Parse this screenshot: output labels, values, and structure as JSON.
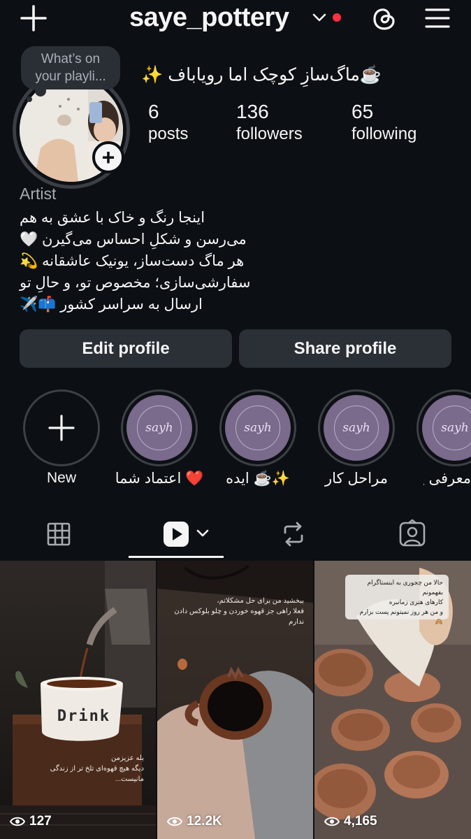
{
  "header": {
    "username": "saye_pottery",
    "icons": [
      "plus-icon",
      "chevron-down-icon",
      "threads-icon",
      "hamburger-menu-icon"
    ],
    "notification_dot_color": "#ff3040"
  },
  "note": {
    "text": "What’s on your playli..."
  },
  "profile": {
    "name": "☕️ماگ‌سازِ کوچک اما رویاباف ✨",
    "stats": [
      {
        "value": "6",
        "label": "posts"
      },
      {
        "value": "136",
        "label": "followers"
      },
      {
        "value": "65",
        "label": "following"
      }
    ],
    "category": "Artist",
    "bio": [
      "اینجا رنگ و خاک با عشق به هم",
      "می‌رسن و شکلِ احساس می‌گیرن 🤍",
      "هر ماگ دست‌ساز، یونیک عاشقانه 💫",
      "سفارشی‌سازی؛ مخصوص تو، و حالِ تو",
      "ارسال به سراسر کشور 📫✈️"
    ]
  },
  "actions": {
    "edit_profile": "Edit profile",
    "share_profile": "Share profile"
  },
  "highlights": [
    {
      "label": "New",
      "cover": ""
    },
    {
      "label": "اعتماد شما ❤️",
      "cover": "sayh"
    },
    {
      "label": "ایده ☕️✨",
      "cover": "sayh"
    },
    {
      "label": "مراحل کار",
      "cover": "sayh"
    },
    {
      "label": "معرفی پیج",
      "cover": "sayh"
    }
  ],
  "tabs": [
    "grid-icon",
    "reels-icon",
    "reposts-icon",
    "tagged-icon"
  ],
  "grid": [
    {
      "views": "127",
      "overlay_lines": [
        "بله عزیزمن",
        "دیگه هیچ قهوه‌ای تلخ تر از زندگی مانیست..."
      ],
      "mug_text": "Drink"
    },
    {
      "views": "12.2K",
      "overlay_lines": [
        "ببخشید من برای حل مشکلاتم،",
        "فعلا راهی جز قهوه خوردن و چلو بلوکس دادن ندارم"
      ]
    },
    {
      "views": "4,165",
      "overlay_lines": [
        "حالا من چجوری به اینستاگرام بفهمونم",
        "کارهای هنری زمانبره",
        "و من هر روز نمیتونم پست بزارم 🙈"
      ]
    }
  ]
}
